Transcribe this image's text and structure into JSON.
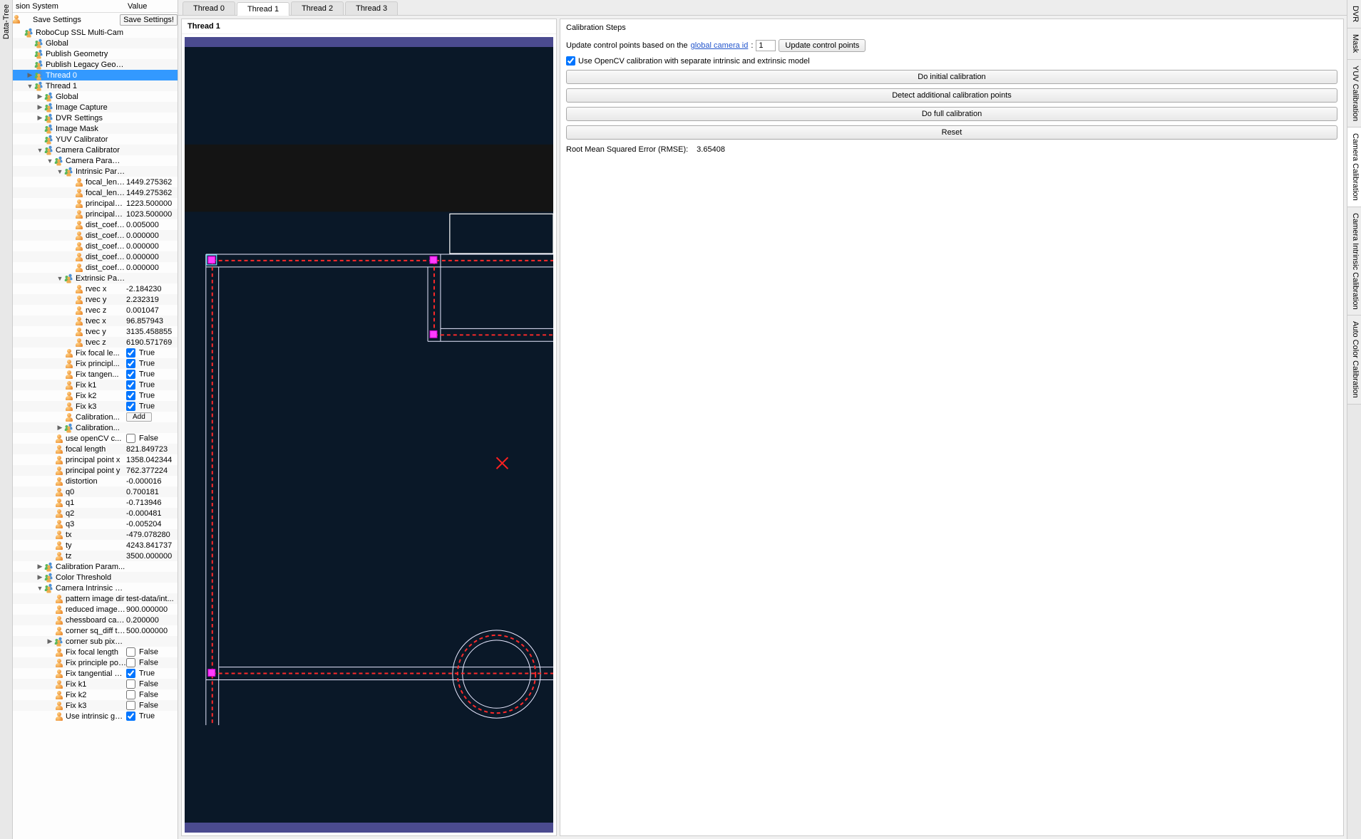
{
  "leftTab": "Data-Tree",
  "treeHeader": {
    "col1": "sion System",
    "col2": "Value"
  },
  "saveRow": {
    "label": "Save Settings",
    "button": "Save Settings!"
  },
  "tree": [
    {
      "depth": 0,
      "icon": "multi",
      "name": "RoboCup SSL Multi-Cam",
      "value": "",
      "toggle": ""
    },
    {
      "depth": 1,
      "icon": "multi",
      "name": "Global",
      "value": "",
      "toggle": ""
    },
    {
      "depth": 1,
      "icon": "multi",
      "name": "Publish Geometry",
      "value": "",
      "toggle": ""
    },
    {
      "depth": 1,
      "icon": "multi",
      "name": "Publish Legacy Geometry",
      "value": "",
      "toggle": ""
    },
    {
      "depth": 1,
      "icon": "multi",
      "name": "Thread 0",
      "value": "",
      "toggle": "▶",
      "selected": true
    },
    {
      "depth": 1,
      "icon": "multi",
      "name": "Thread 1",
      "value": "",
      "toggle": "▼"
    },
    {
      "depth": 2,
      "icon": "multi",
      "name": "Global",
      "value": "",
      "toggle": "▶"
    },
    {
      "depth": 2,
      "icon": "multi",
      "name": "Image Capture",
      "value": "",
      "toggle": "▶"
    },
    {
      "depth": 2,
      "icon": "multi",
      "name": "DVR Settings",
      "value": "",
      "toggle": "▶"
    },
    {
      "depth": 2,
      "icon": "multi",
      "name": "Image Mask",
      "value": "",
      "toggle": ""
    },
    {
      "depth": 2,
      "icon": "multi",
      "name": "YUV Calibrator",
      "value": "",
      "toggle": ""
    },
    {
      "depth": 2,
      "icon": "multi",
      "name": "Camera Calibrator",
      "value": "",
      "toggle": "▼"
    },
    {
      "depth": 3,
      "icon": "multi",
      "name": "Camera Paramet...",
      "value": "",
      "toggle": "▼"
    },
    {
      "depth": 4,
      "icon": "multi",
      "name": "Intrinsic Para...",
      "value": "",
      "toggle": "▼"
    },
    {
      "depth": 5,
      "icon": "single",
      "name": "focal_lengt...",
      "value": "1449.275362"
    },
    {
      "depth": 5,
      "icon": "single",
      "name": "focal_lengt...",
      "value": "1449.275362"
    },
    {
      "depth": 5,
      "icon": "single",
      "name": "principal_p...",
      "value": "1223.500000"
    },
    {
      "depth": 5,
      "icon": "single",
      "name": "principal_p...",
      "value": "1023.500000"
    },
    {
      "depth": 5,
      "icon": "single",
      "name": "dist_coeff_k1",
      "value": "0.005000"
    },
    {
      "depth": 5,
      "icon": "single",
      "name": "dist_coeff_k2",
      "value": "0.000000"
    },
    {
      "depth": 5,
      "icon": "single",
      "name": "dist_coeff_p1",
      "value": "0.000000"
    },
    {
      "depth": 5,
      "icon": "single",
      "name": "dist_coeff_p2",
      "value": "0.000000"
    },
    {
      "depth": 5,
      "icon": "single",
      "name": "dist_coeff_k3",
      "value": "0.000000"
    },
    {
      "depth": 4,
      "icon": "multi",
      "name": "Extrinsic Para...",
      "value": "",
      "toggle": "▼"
    },
    {
      "depth": 5,
      "icon": "single",
      "name": "rvec x",
      "value": "-2.184230"
    },
    {
      "depth": 5,
      "icon": "single",
      "name": "rvec y",
      "value": "2.232319"
    },
    {
      "depth": 5,
      "icon": "single",
      "name": "rvec z",
      "value": "0.001047"
    },
    {
      "depth": 5,
      "icon": "single",
      "name": "tvec x",
      "value": "96.857943"
    },
    {
      "depth": 5,
      "icon": "single",
      "name": "tvec y",
      "value": "3135.458855"
    },
    {
      "depth": 5,
      "icon": "single",
      "name": "tvec z",
      "value": "6190.571769"
    },
    {
      "depth": 4,
      "icon": "single",
      "name": "Fix focal le...",
      "value": "True",
      "check": true
    },
    {
      "depth": 4,
      "icon": "single",
      "name": "Fix principl...",
      "value": "True",
      "check": true
    },
    {
      "depth": 4,
      "icon": "single",
      "name": "Fix tangen...",
      "value": "True",
      "check": true
    },
    {
      "depth": 4,
      "icon": "single",
      "name": "Fix k1",
      "value": "True",
      "check": true
    },
    {
      "depth": 4,
      "icon": "single",
      "name": "Fix k2",
      "value": "True",
      "check": true
    },
    {
      "depth": 4,
      "icon": "single",
      "name": "Fix k3",
      "value": "True",
      "check": true
    },
    {
      "depth": 4,
      "icon": "single",
      "name": "Calibration...",
      "value": "Add",
      "btn": true
    },
    {
      "depth": 4,
      "icon": "multi",
      "name": "Calibration...",
      "value": "",
      "toggle": "▶"
    },
    {
      "depth": 3,
      "icon": "single",
      "name": "use openCV c...",
      "value": "False",
      "check": false
    },
    {
      "depth": 3,
      "icon": "single",
      "name": "focal length",
      "value": "821.849723"
    },
    {
      "depth": 3,
      "icon": "single",
      "name": "principal point x",
      "value": "1358.042344"
    },
    {
      "depth": 3,
      "icon": "single",
      "name": "principal point y",
      "value": "762.377224"
    },
    {
      "depth": 3,
      "icon": "single",
      "name": "distortion",
      "value": "-0.000016"
    },
    {
      "depth": 3,
      "icon": "single",
      "name": "q0",
      "value": "0.700181"
    },
    {
      "depth": 3,
      "icon": "single",
      "name": "q1",
      "value": "-0.713946"
    },
    {
      "depth": 3,
      "icon": "single",
      "name": "q2",
      "value": "-0.000481"
    },
    {
      "depth": 3,
      "icon": "single",
      "name": "q3",
      "value": "-0.005204"
    },
    {
      "depth": 3,
      "icon": "single",
      "name": "tx",
      "value": "-479.078280"
    },
    {
      "depth": 3,
      "icon": "single",
      "name": "ty",
      "value": "4243.841737"
    },
    {
      "depth": 3,
      "icon": "single",
      "name": "tz",
      "value": "3500.000000"
    },
    {
      "depth": 2,
      "icon": "multi",
      "name": "Calibration Param...",
      "value": "",
      "toggle": "▶"
    },
    {
      "depth": 2,
      "icon": "multi",
      "name": "Color Threshold",
      "value": "",
      "toggle": "▶"
    },
    {
      "depth": 2,
      "icon": "multi",
      "name": "Camera Intrinsic Cali...",
      "value": "",
      "toggle": "▼"
    },
    {
      "depth": 3,
      "icon": "single",
      "name": "pattern image dir",
      "value": "test-data/int..."
    },
    {
      "depth": 3,
      "icon": "single",
      "name": "reduced image wi...",
      "value": "900.000000"
    },
    {
      "depth": 3,
      "icon": "single",
      "name": "chessboard captu...",
      "value": "0.200000"
    },
    {
      "depth": 3,
      "icon": "single",
      "name": "corner sq_diff th...",
      "value": "500.000000"
    },
    {
      "depth": 3,
      "icon": "multi",
      "name": "corner sub pixel d...",
      "value": "",
      "toggle": "▶"
    },
    {
      "depth": 3,
      "icon": "single",
      "name": "Fix focal length",
      "value": "False",
      "check": false
    },
    {
      "depth": 3,
      "icon": "single",
      "name": "Fix principle point",
      "value": "False",
      "check": false
    },
    {
      "depth": 3,
      "icon": "single",
      "name": "Fix tangential dist...",
      "value": "True",
      "check": true
    },
    {
      "depth": 3,
      "icon": "single",
      "name": "Fix k1",
      "value": "False",
      "check": false
    },
    {
      "depth": 3,
      "icon": "single",
      "name": "Fix k2",
      "value": "False",
      "check": false
    },
    {
      "depth": 3,
      "icon": "single",
      "name": "Fix k3",
      "value": "False",
      "check": false
    },
    {
      "depth": 3,
      "icon": "single",
      "name": "Use intrinsic guess",
      "value": "True",
      "check": true
    }
  ],
  "tabs": [
    "Thread 0",
    "Thread 1",
    "Thread 2",
    "Thread 3"
  ],
  "activeTab": 1,
  "camTitle": "Thread 1",
  "calib": {
    "title": "Calibration Steps",
    "updateText1": "Update control points based on the ",
    "updateLink": "global camera id",
    "updateText2": ":",
    "camIdValue": "1",
    "updateBtn": "Update control points",
    "opencvCheck": true,
    "opencvLabel": "Use OpenCV calibration with separate intrinsic and extrinsic model",
    "btn1": "Do initial calibration",
    "btn2": "Detect additional calibration points",
    "btn3": "Do full calibration",
    "btn4": "Reset",
    "rmseLabel": "Root Mean Squared Error (RMSE):",
    "rmseValue": "3.65408"
  },
  "rightTabs": [
    "DVR",
    "Mask",
    "YUV Calibration",
    "Camera Calibration",
    "Camera Intrinsic Calibration",
    "Auto Color Calibration"
  ],
  "activeRightTab": 3
}
